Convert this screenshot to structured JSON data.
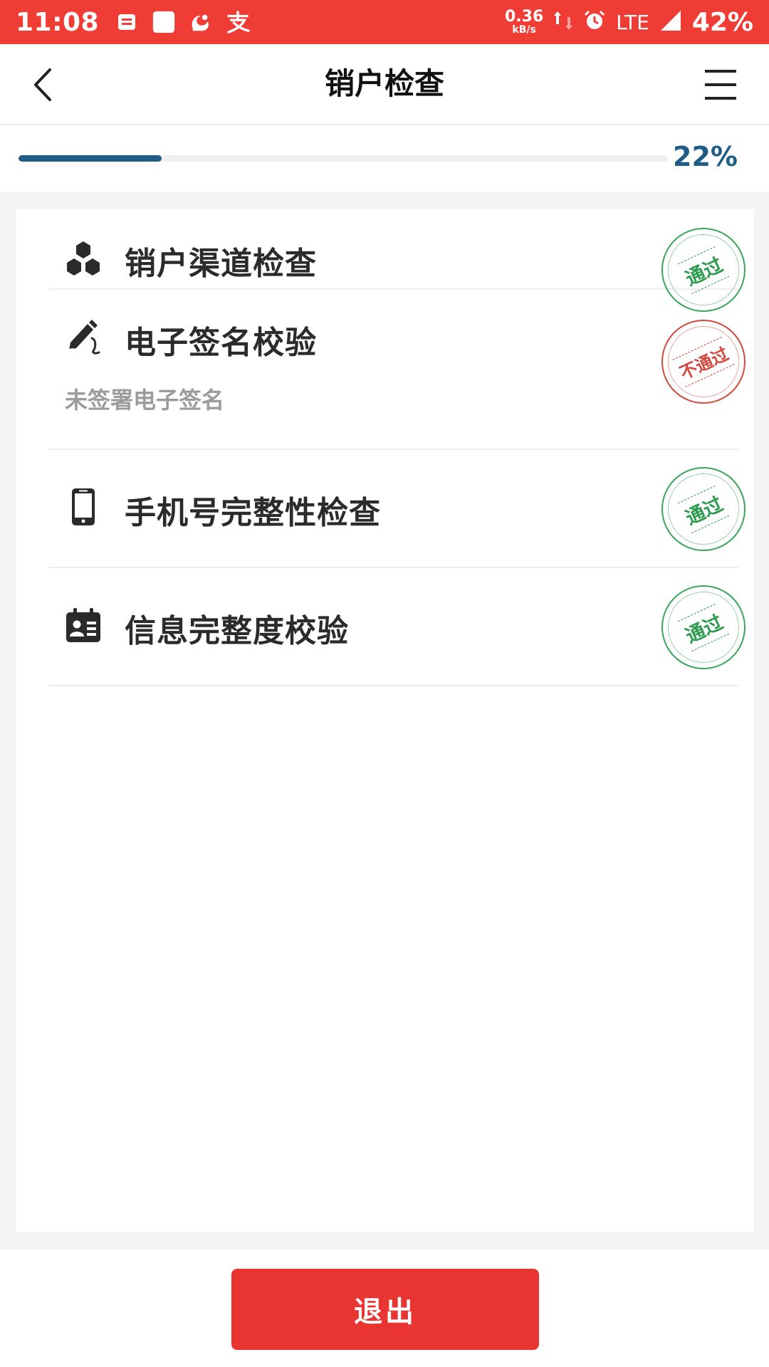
{
  "status_bar": {
    "time": "11:08",
    "network_speed": "0.36",
    "network_unit": "kB/s",
    "network_type": "LTE",
    "battery": "42%",
    "background_color": "#ef3d36",
    "icons": [
      "notification-icon",
      "app-square-icon",
      "uc-browser-icon",
      "alipay-icon",
      "upload-arrow-icon",
      "download-arrow-icon",
      "alarm-icon",
      "signal-icon"
    ]
  },
  "header": {
    "title": "销户检查",
    "back_icon": "chevron-left-icon",
    "menu_icon": "menu-icon"
  },
  "progress": {
    "percent_value": 22,
    "label": "22%",
    "color": "#1f5d86"
  },
  "checks": [
    {
      "title": "销户渠道检查",
      "icon": "cubes-icon",
      "status": "pass",
      "stamp_text": "通过"
    },
    {
      "title": "电子签名校验",
      "subtitle": "未签署电子签名",
      "icon": "pen-icon",
      "status": "fail",
      "stamp_text": "不通过"
    },
    {
      "title": "手机号完整性检查",
      "icon": "phone-icon",
      "status": "pass",
      "stamp_text": "通过"
    },
    {
      "title": "信息完整度校验",
      "icon": "id-card-icon",
      "status": "pass",
      "stamp_text": "通过"
    }
  ],
  "colors": {
    "pass": "#2c9b4e",
    "fail": "#d1493f",
    "exit_button": "#e83532"
  },
  "footer": {
    "exit_label": "退出"
  }
}
